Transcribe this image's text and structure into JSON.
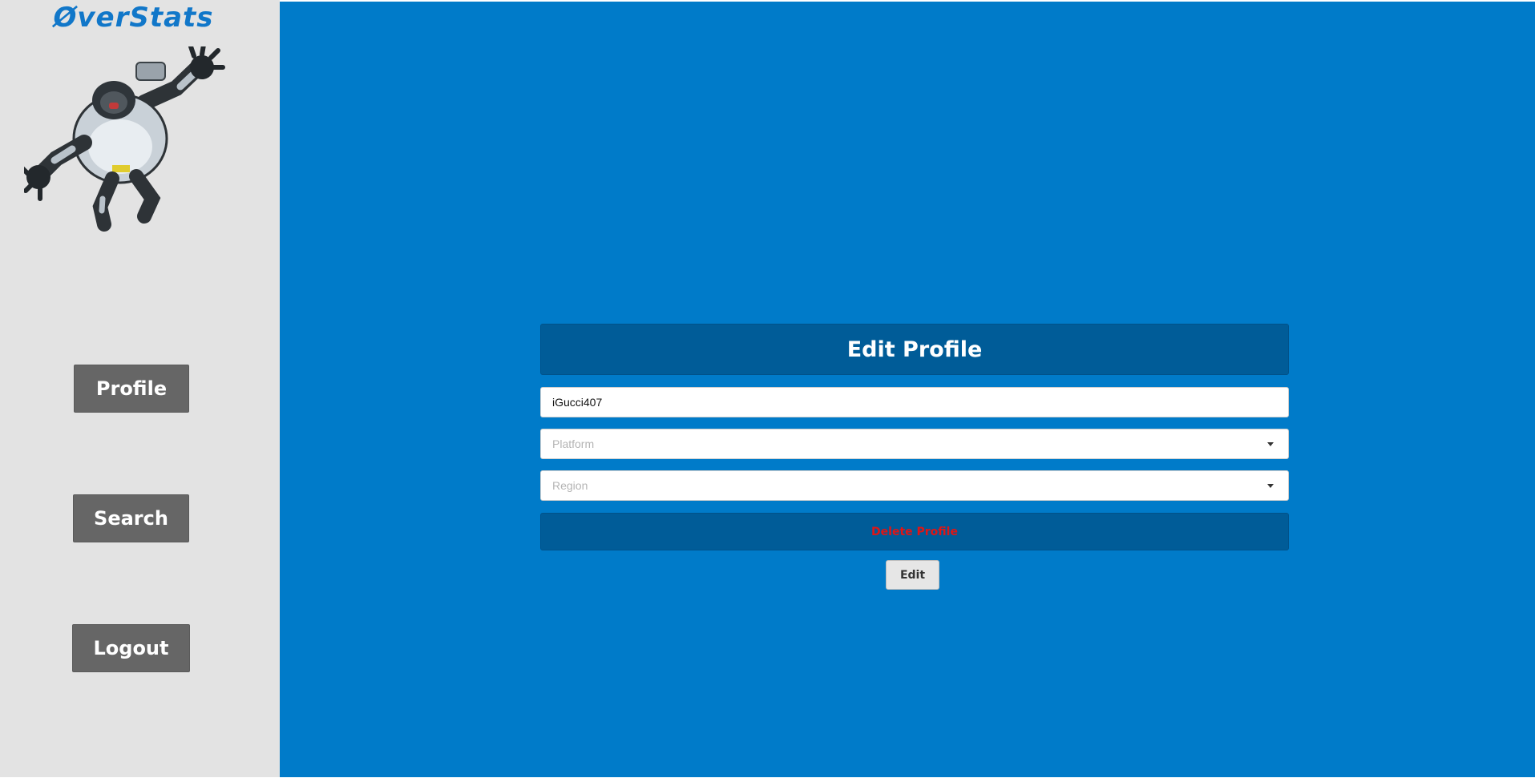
{
  "app": {
    "logo_text": "ØverStats"
  },
  "sidebar": {
    "hero_image": "winston-character-illustration",
    "nav": [
      {
        "label": "Profile"
      },
      {
        "label": "Search"
      },
      {
        "label": "Logout"
      }
    ]
  },
  "form": {
    "title": "Edit Profile",
    "username_value": "iGucci407",
    "platform_placeholder": "Platform",
    "region_placeholder": "Region",
    "delete_label": "Delete Profile",
    "edit_label": "Edit"
  },
  "icons": {
    "select_caret": "caret-down-icon"
  },
  "colors": {
    "sidebar_bg": "#e3e3e3",
    "main_bg": "#007bc9",
    "panel_bg": "#005c98",
    "nav_button_bg": "#666666",
    "logo_blue": "#1177c9",
    "delete_text": "#e01515"
  }
}
